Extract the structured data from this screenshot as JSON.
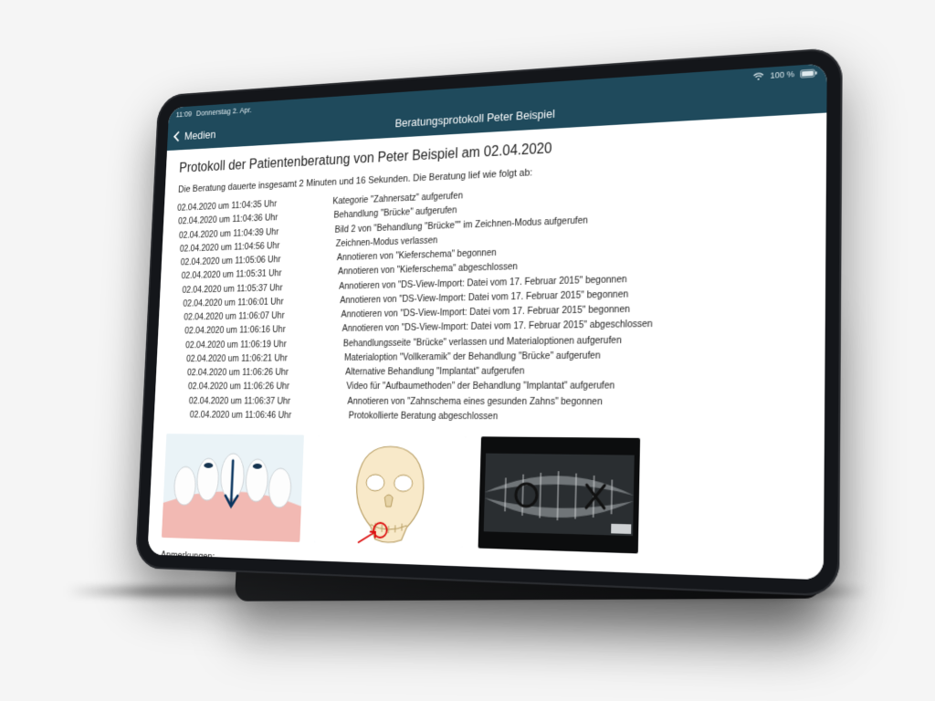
{
  "statusbar": {
    "time": "11:09",
    "date": "Donnerstag 2. Apr.",
    "battery": "100 %"
  },
  "navbar": {
    "back_label": "Medien",
    "title": "Beratungsprotokoll Peter Beispiel"
  },
  "document": {
    "heading": "Protokoll der Patientenberatung von Peter Beispiel am 02.04.2020",
    "intro": "Die Beratung dauerte insgesamt 2 Minuten und 16 Sekunden. Die Beratung lief wie folgt ab:",
    "log": [
      {
        "ts": "02.04.2020 um 11:04:35 Uhr",
        "msg": "Kategorie \"Zahnersatz\" aufgerufen"
      },
      {
        "ts": "02.04.2020 um 11:04:36 Uhr",
        "msg": "Behandlung \"Brücke\" aufgerufen"
      },
      {
        "ts": "02.04.2020 um 11:04:39 Uhr",
        "msg": "Bild 2 von \"Behandlung \"Brücke\"\" im Zeichnen-Modus aufgerufen"
      },
      {
        "ts": "02.04.2020 um 11:04:56 Uhr",
        "msg": "Zeichnen-Modus verlassen"
      },
      {
        "ts": "02.04.2020 um 11:05:06 Uhr",
        "msg": "Annotieren von \"Kieferschema\" begonnen"
      },
      {
        "ts": "02.04.2020 um 11:05:31 Uhr",
        "msg": "Annotieren von \"Kieferschema\" abgeschlossen"
      },
      {
        "ts": "02.04.2020 um 11:05:37 Uhr",
        "msg": "Annotieren von \"DS-View-Import: Datei vom 17. Februar 2015\" begonnen"
      },
      {
        "ts": "02.04.2020 um 11:06:01 Uhr",
        "msg": "Annotieren von \"DS-View-Import: Datei vom 17. Februar 2015\" begonnen"
      },
      {
        "ts": "02.04.2020 um 11:06:07 Uhr",
        "msg": "Annotieren von \"DS-View-Import: Datei vom 17. Februar 2015\" begonnen"
      },
      {
        "ts": "02.04.2020 um 11:06:16 Uhr",
        "msg": "Annotieren von \"DS-View-Import: Datei vom 17. Februar 2015\" abgeschlossen"
      },
      {
        "ts": "02.04.2020 um 11:06:19 Uhr",
        "msg": "Behandlungsseite \"Brücke\" verlassen und Materialoptionen aufgerufen"
      },
      {
        "ts": "02.04.2020 um 11:06:21 Uhr",
        "msg": "Materialoption \"Vollkeramik\" der Behandlung \"Brücke\" aufgerufen"
      },
      {
        "ts": "02.04.2020 um 11:06:26 Uhr",
        "msg": "Alternative Behandlung \"Implantat\" aufgerufen"
      },
      {
        "ts": "02.04.2020 um 11:06:26 Uhr",
        "msg": "Video für \"Aufbaumethoden\" der Behandlung \"Implantat\" aufgerufen"
      },
      {
        "ts": "02.04.2020 um 11:06:37 Uhr",
        "msg": "Annotieren von \"Zahnschema eines gesunden Zahns\" begonnen"
      },
      {
        "ts": "02.04.2020 um 11:06:46 Uhr",
        "msg": "Protokollierte Beratung abgeschlossen"
      }
    ],
    "images": [
      {
        "name": "teeth-illustration",
        "alt": "Zahnillustration mit Pfeil"
      },
      {
        "name": "skull-illustration",
        "alt": "Schädel-/Kieferschema"
      },
      {
        "name": "xray-panorama",
        "alt": "Panorama-Röntgenaufnahme"
      }
    ],
    "notes_label": "Anmerkungen:"
  },
  "colors": {
    "navbar_bg": "#1f4a5c",
    "text": "#222222"
  }
}
